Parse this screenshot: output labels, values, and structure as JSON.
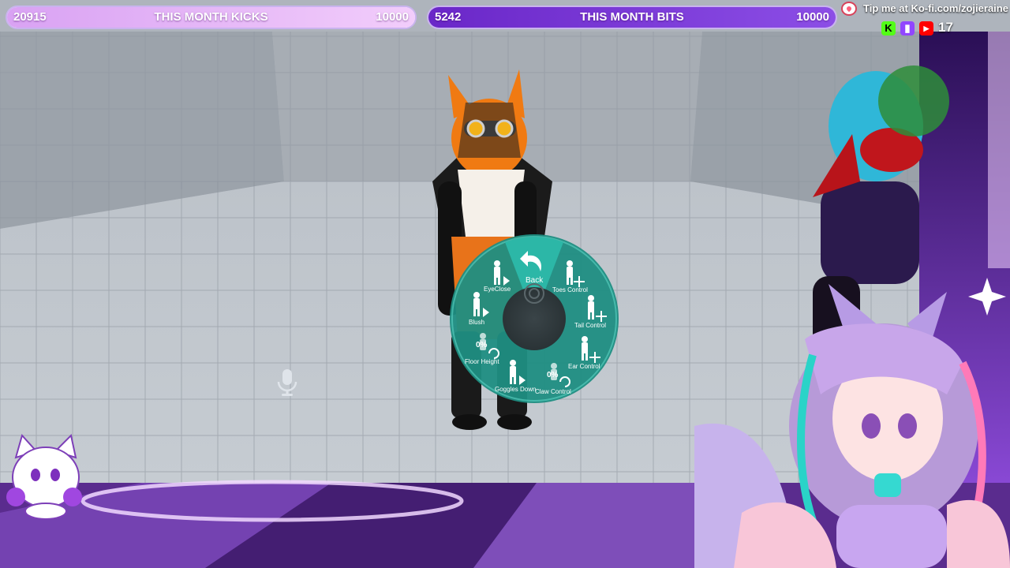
{
  "goals": {
    "kicks": {
      "current": "20915",
      "title": "THIS MONTH KICKS",
      "max": "10000"
    },
    "bits": {
      "current": "5242",
      "title": "THIS MONTH BITS",
      "max": "10000"
    }
  },
  "tip": {
    "text": "Tip me at Ko-fi.com/zojieraine"
  },
  "platforms": {
    "kick": "K",
    "viewer_count": "17"
  },
  "radial_menu": {
    "back_label": "Back",
    "items": [
      {
        "label": "EyeClose",
        "icon": "figure-play-icon"
      },
      {
        "label": "Toes Control",
        "icon": "figure-move-icon"
      },
      {
        "label": "Blush",
        "icon": "figure-play-icon"
      },
      {
        "label": "Tail Control",
        "icon": "figure-move-icon"
      },
      {
        "label": "Floor Height",
        "icon": "figure-radial-icon",
        "percent": "0%"
      },
      {
        "label": "Ear Control",
        "icon": "figure-move-icon"
      },
      {
        "label": "Goggles Down",
        "icon": "figure-play-icon"
      },
      {
        "label": "Claw Control",
        "icon": "figure-radial-icon",
        "percent": "0%"
      }
    ]
  },
  "colors": {
    "menu_teal": "#1d8f82",
    "menu_dark": "#2b3a3e",
    "kicks_fill": "#e6b8f7",
    "bits_fill": "#7a36d8",
    "floor_purple": "#6b3a9e"
  }
}
